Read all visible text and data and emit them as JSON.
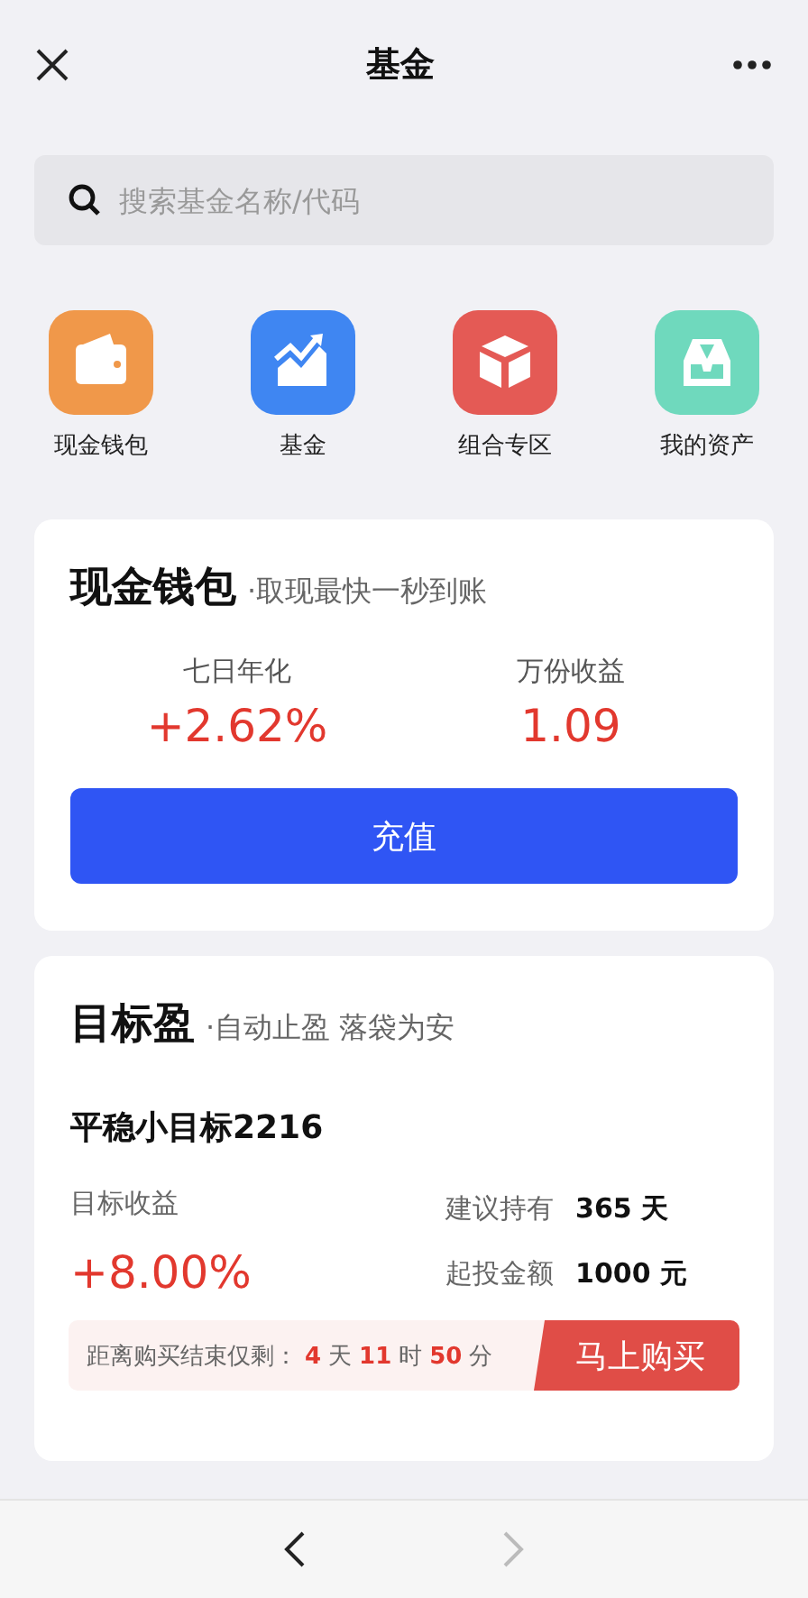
{
  "header": {
    "title": "基金"
  },
  "search": {
    "placeholder": "搜索基金名称/代码"
  },
  "shortcuts": [
    {
      "label": "现金钱包",
      "kind": "wallet",
      "color": "#f0984a"
    },
    {
      "label": "基金",
      "kind": "chart",
      "color": "#3f86f2"
    },
    {
      "label": "组合专区",
      "kind": "cube",
      "color": "#e45a55"
    },
    {
      "label": "我的资产",
      "kind": "inbox",
      "color": "#6fd9bd"
    }
  ],
  "wallet_card": {
    "title": "现金钱包",
    "subtitle": "·取现最快一秒到账",
    "stats": [
      {
        "label": "七日年化",
        "value": "+2.62%"
      },
      {
        "label": "万份收益",
        "value": "1.09"
      }
    ],
    "button": "充值"
  },
  "goal_card": {
    "title": "目标盈",
    "subtitle": "·自动止盈 落袋为安",
    "product": "平稳小目标2216",
    "return_label": "目标收益",
    "return_value": "+8.00%",
    "details": [
      {
        "label": "建议持有",
        "value": "365",
        "unit": "天"
      },
      {
        "label": "起投金额",
        "value": "1000",
        "unit": "元"
      }
    ],
    "countdown": {
      "label": "距离购买结束仅剩：",
      "parts": [
        {
          "value": "4",
          "unit": "天"
        },
        {
          "value": "11",
          "unit": "时"
        },
        {
          "value": "50",
          "unit": "分"
        }
      ]
    },
    "button": "马上购买"
  },
  "nav": {
    "back": {
      "disabled": false
    },
    "forward": {
      "disabled": true
    }
  }
}
